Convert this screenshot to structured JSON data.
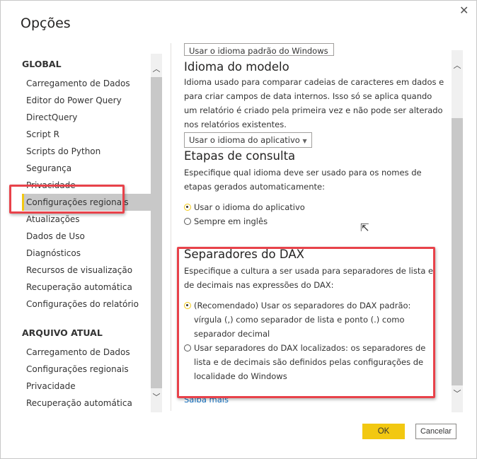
{
  "dialog": {
    "title": "Opções",
    "close_icon": "close-icon"
  },
  "sidebar": {
    "global_header": "GLOBAL",
    "global_items": [
      {
        "label": "Carregamento de Dados"
      },
      {
        "label": "Editor do Power Query"
      },
      {
        "label": "DirectQuery"
      },
      {
        "label": "Script R"
      },
      {
        "label": "Scripts do Python"
      },
      {
        "label": "Segurança"
      },
      {
        "label": "Privacidade"
      },
      {
        "label": "Configurações regionais",
        "active": true
      },
      {
        "label": "Atualizações"
      },
      {
        "label": "Dados de Uso"
      },
      {
        "label": "Diagnósticos"
      },
      {
        "label": "Recursos de visualização"
      },
      {
        "label": "Recuperação automática"
      },
      {
        "label": "Configurações do relatório"
      }
    ],
    "current_header": "ARQUIVO ATUAL",
    "current_items": [
      {
        "label": "Carregamento de Dados"
      },
      {
        "label": "Configurações regionais"
      },
      {
        "label": "Privacidade"
      },
      {
        "label": "Recuperação automática"
      }
    ]
  },
  "content": {
    "top_dropdown_value": "Usar o idioma padrão do Windows",
    "model_language": {
      "title": "Idioma do modelo",
      "description": "Idioma usado para comparar cadeias de caracteres em dados e para criar campos de data internos. Isso só se aplica quando um relatório é criado pela primeira vez e não pode ser alterado nos relatórios existentes.",
      "dropdown_value": "Usar o idioma do aplicativo"
    },
    "query_steps": {
      "title": "Etapas de consulta",
      "description": "Especifique qual idioma deve ser usado para os nomes de etapas gerados automaticamente:",
      "options": [
        {
          "label": "Usar o idioma do aplicativo",
          "selected": true
        },
        {
          "label": "Sempre em inglês",
          "selected": false
        }
      ]
    },
    "dax_separators": {
      "title": "Separadores do DAX",
      "description": "Especifique a cultura a ser usada para separadores de lista e de decimais nas expressões do DAX:",
      "options": [
        {
          "label": "(Recomendado) Usar os separadores do DAX padrão: vírgula (,) como separador de lista e ponto (.) como separador decimal",
          "selected": true
        },
        {
          "label": "Usar separadores do DAX localizados: os separadores de lista e de decimais são definidos pelas configurações de localidade do Windows",
          "selected": false
        }
      ]
    },
    "learn_more": "Saiba mais"
  },
  "footer": {
    "ok": "OK",
    "cancel": "Cancelar"
  },
  "colors": {
    "accent": "#f2c811",
    "highlight": "#e8424a",
    "link": "#0f6cbd"
  }
}
